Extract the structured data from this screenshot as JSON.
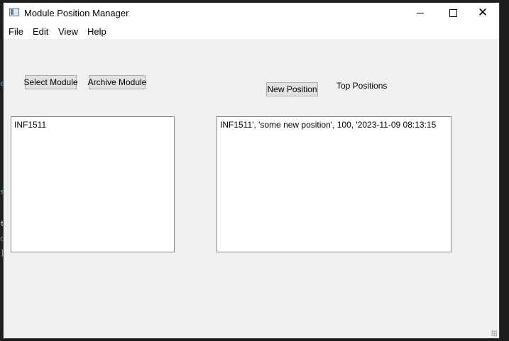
{
  "window": {
    "title": "Module Position Manager",
    "controls": {
      "minimize": "minimize",
      "maximize": "maximize",
      "close": "✕"
    }
  },
  "menu": {
    "items": [
      {
        "label": "File"
      },
      {
        "label": "Edit"
      },
      {
        "label": "View"
      },
      {
        "label": "Help"
      }
    ]
  },
  "toolbar": {
    "select_module": "Select Module",
    "archive_module": "Archive Module",
    "new_position": "New Position",
    "top_positions_label": "Top Positions"
  },
  "modules_list": {
    "items": [
      "INF1511"
    ]
  },
  "positions_list": {
    "items": [
      "INF1511', 'some new position', 100, '2023-11-09 08:13:15"
    ]
  },
  "colors": {
    "window_bg": "#f0f0f0",
    "titlebar_bg": "#ffffff",
    "button_bg": "#e1e1e1",
    "button_border": "#adadad",
    "list_border": "#828790"
  }
}
